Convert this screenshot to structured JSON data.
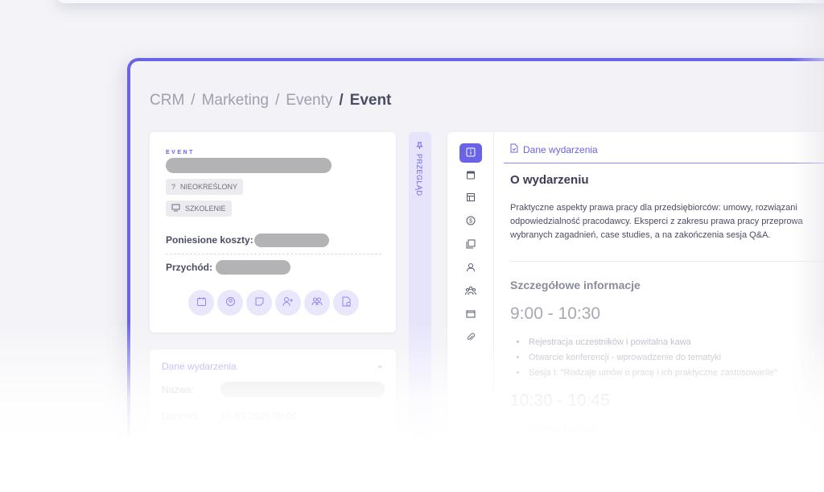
{
  "breadcrumb": {
    "items": [
      "CRM",
      "Marketing",
      "Eventy"
    ],
    "current": "Event"
  },
  "event_card": {
    "label": "EVENT",
    "tag_status": "NIEOKREŚLONY",
    "tag_type": "SZKOLENIE",
    "costs_label": "Poniesione koszty:",
    "revenue_label": "Przychód:"
  },
  "details_card": {
    "title": "Dane wydarzenia",
    "name_label": "Nazwa:",
    "date_label": "Data od:",
    "date_value": "10-03-2025 09:00"
  },
  "vertical_tab": {
    "label": "PRZEGLĄD"
  },
  "main": {
    "tab_title": "Dane wydarzenia",
    "about_heading": "O wydarzeniu",
    "description_lines": [
      "Praktyczne aspekty prawa pracy dla przedsiębiorców: umowy, rozwiązani",
      "odpowiedzialność pracodawcy. Eksperci z zakresu prawa pracy przeprowa",
      "wybranych zagadnień, case studies, a na zakończenia sesja Q&A."
    ],
    "details_heading": "Szczegółowe informacje",
    "slot1_time": "9:00 - 10:30",
    "slot1_items": [
      "Rejestracja uczestników i powitalna kawa",
      "Otwarcie konferencji - wprowadzenie do tematyki",
      "Sesja I: \"Rodzaje umów o pracę i ich praktyczne zastosowanie\""
    ],
    "slot2_time": "10:30 - 10:45",
    "slot2_items": [
      "Przerwa kawowa"
    ]
  },
  "colors": {
    "accent": "#6b63e6",
    "accent_light": "#e9e7fb"
  }
}
